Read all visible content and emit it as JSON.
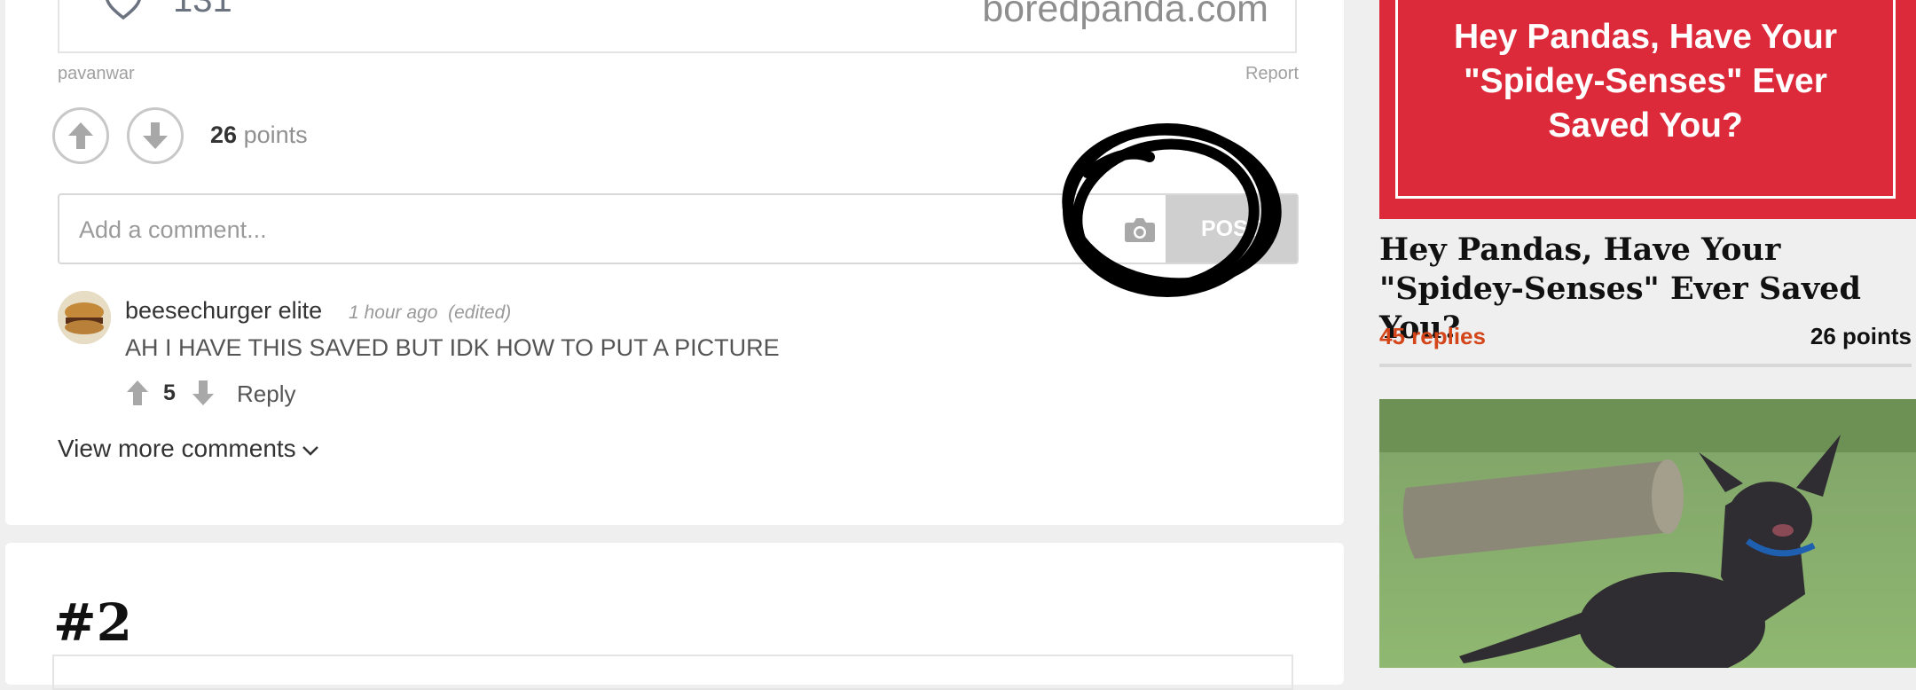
{
  "post": {
    "likes": "131",
    "watermark": "boredpanda.com",
    "author": "pavanwar",
    "report_label": "Report",
    "points_value": "26",
    "points_label": "points"
  },
  "comment_form": {
    "placeholder": "Add a comment...",
    "post_label": "POST"
  },
  "comment": {
    "user": "beesechurger elite",
    "time": "1 hour ago",
    "edited": "(edited)",
    "text": "AH I HAVE THIS SAVED BUT IDK HOW TO PUT A PICTURE",
    "score": "5",
    "reply_label": "Reply"
  },
  "view_more_label": "View more comments",
  "next_item_number": "#2",
  "sidebar": {
    "promo_text": "Hey Pandas, Have Your \"Spidey-Senses\" Ever Saved You?",
    "title": "Hey Pandas, Have Your \"Spidey-Senses\" Ever Saved You?",
    "replies": "45 replies",
    "points": "26 points"
  },
  "colors": {
    "promo_red": "#dc2a3a",
    "replies_orange": "#d4461a"
  }
}
